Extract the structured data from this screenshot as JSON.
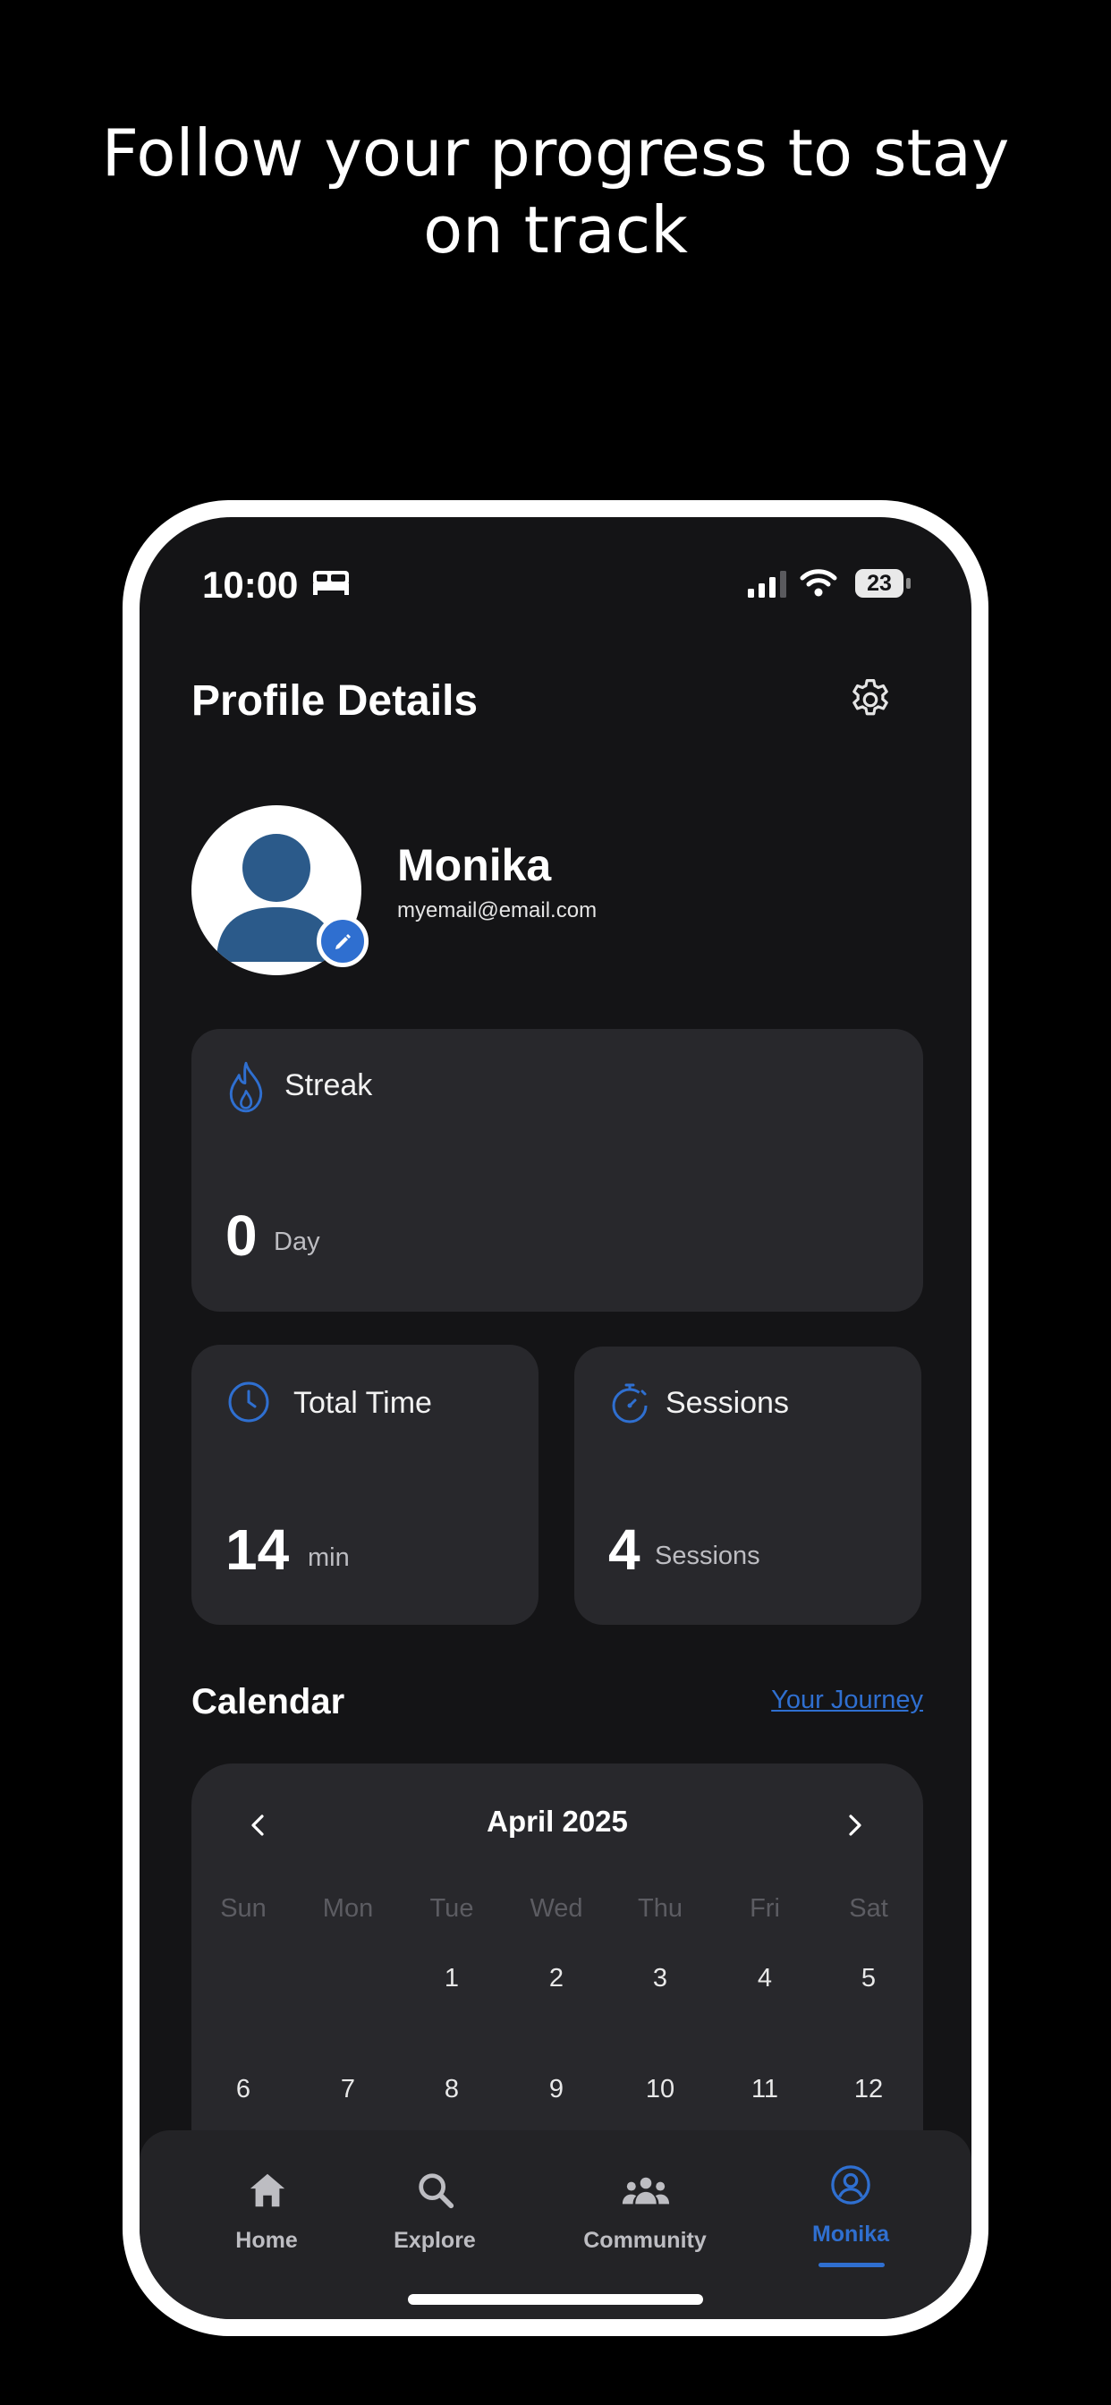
{
  "headline": {
    "line1": "Follow your progress to stay",
    "line2": "on track"
  },
  "status_bar": {
    "time": "10:00",
    "battery": "23"
  },
  "profile": {
    "title": "Profile Details",
    "name": "Monika",
    "email": "myemail@email.com"
  },
  "stats": {
    "streak": {
      "label": "Streak",
      "value": "0",
      "unit": "Day"
    },
    "total_time": {
      "label": "Total Time",
      "value": "14",
      "unit": "min"
    },
    "sessions": {
      "label": "Sessions",
      "value": "4",
      "unit": "Sessions"
    }
  },
  "calendar": {
    "title": "Calendar",
    "link": "Your Journey",
    "month": "April 2025",
    "weekdays": [
      "Sun",
      "Mon",
      "Tue",
      "Wed",
      "Thu",
      "Fri",
      "Sat"
    ],
    "week1": [
      "",
      "",
      "1",
      "2",
      "3",
      "4",
      "5"
    ],
    "week2": [
      "6",
      "7",
      "8",
      "9",
      "10",
      "11",
      "12"
    ]
  },
  "tabs": [
    {
      "label": "Home",
      "icon": "home-icon"
    },
    {
      "label": "Explore",
      "icon": "search-icon"
    },
    {
      "label": "Community",
      "icon": "community-icon"
    },
    {
      "label": "Monika",
      "icon": "profile-icon"
    }
  ],
  "colors": {
    "accent": "#2f6fd0",
    "background": "#000000",
    "screen": "#141416",
    "card": "#28282c",
    "tab_inactive": "#bdbdc2"
  }
}
